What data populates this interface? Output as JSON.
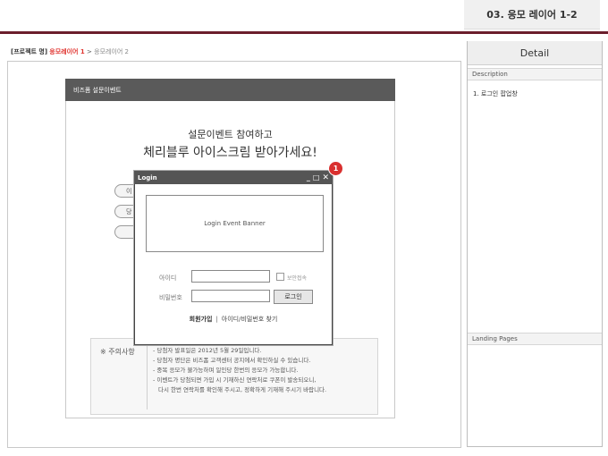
{
  "header": {
    "page_code": "03. 응모 레이어 1-2"
  },
  "breadcrumb": {
    "project": "[프로젝트 명]",
    "current": "응모레이어 1",
    "sep": " > ",
    "next": "응모레이어 2"
  },
  "form": {
    "header_title": "비즈폼 설문이벤트",
    "intro_line1": "설문이벤트 참여하고",
    "intro_line2": "체리블루 아이스크림 받아가세요!",
    "pill1": "이",
    "pill2": "당",
    "pill3": ""
  },
  "caution": {
    "label": "※ 주의사항",
    "lines": [
      "- 당첨자 발표일은 2012년 5월 29일입니다.",
      "- 당첨자 명단은 비즈폼 고객센터 공지에서 확인하실 수 있습니다.",
      "- 중복 응모가 불가능하며 일인당 한번의 응모가 가능합니다.",
      "- 이벤트가 당첨되면 가입 시 기재하신 연락처로 쿠폰이 발송되오니,",
      "  다시 한번 연락처를 확인해 주시고, 정확하게 기재해 주시기 바랍니다."
    ]
  },
  "login_popup": {
    "title": "Login",
    "minimize": "_",
    "maximize": "□",
    "close": "✕",
    "badge": "1",
    "banner": "Login Event Banner",
    "id_label": "아이디",
    "pw_label": "비밀번호",
    "secure_label": "보안접속",
    "login_button": "로그인",
    "join_link": "회원가입",
    "link_sep": "|",
    "find_link": "아이디/비밀번호 찾기"
  },
  "right_panel": {
    "title": "Detail",
    "description_label": "Description",
    "description_item": "1. 로그인 팝업창",
    "landing_label": "Landing Pages"
  }
}
